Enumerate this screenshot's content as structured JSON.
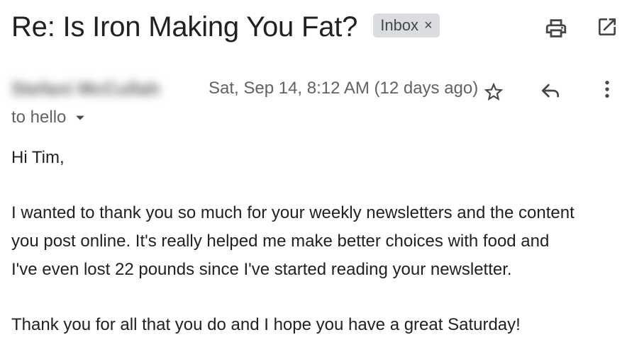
{
  "email": {
    "subject": "Re: Is Iron Making You Fat?",
    "label": "Inbox",
    "label_close": "×",
    "sender_name": "Stefani McCullah",
    "date": "Sat, Sep 14, 8:12 AM (12 days ago)",
    "to_text": "to hello",
    "body": {
      "greeting": "Hi Tim,",
      "paragraph1": "I wanted to thank you so much for your weekly newsletters and the content\nyou post online. It's really helped me make better choices with food and\nI've even lost 22 pounds since I've started reading your newsletter.",
      "paragraph2": "Thank you for all that you do and I hope you have a great Saturday!"
    }
  },
  "icons": {
    "print": "print-icon",
    "open_new_window": "open-in-new-window-icon",
    "star": "star-icon",
    "reply": "reply-icon",
    "more": "more-vert-icon",
    "details": "chevron-down-icon"
  },
  "colors": {
    "text_primary": "#202124",
    "text_secondary": "#5f6368",
    "chip_background": "#dadce0",
    "icon": "#444746"
  }
}
